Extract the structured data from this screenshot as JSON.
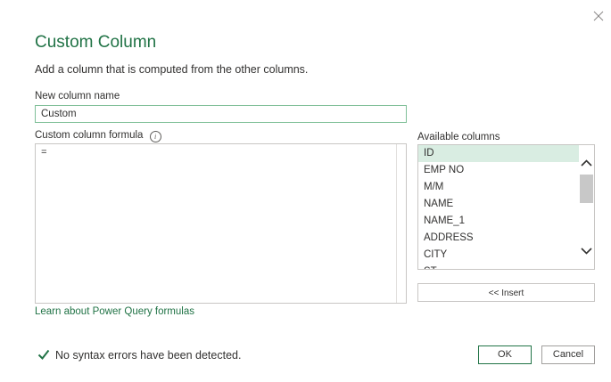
{
  "dialog": {
    "close_icon": "close-icon",
    "title": "Custom Column",
    "subtitle": "Add a column that is computed from the other columns.",
    "new_column_label": "New column name",
    "new_column_value": "Custom",
    "formula_label": "Custom column formula",
    "info_icon": "info-icon",
    "formula_value": "=",
    "available_label": "Available columns",
    "columns": [
      "ID",
      "EMP NO",
      "M/M",
      "NAME",
      "NAME_1",
      "ADDRESS",
      "CITY",
      "ST"
    ],
    "selected_column": "ID",
    "insert_label": "<< Insert",
    "learn_link": "Learn about Power Query formulas",
    "status_text": "No syntax errors have been detected.",
    "status_icon": "checkmark-icon",
    "ok_label": "OK",
    "cancel_label": "Cancel"
  },
  "colors": {
    "accent": "#217346",
    "selection": "#d9ede2",
    "border": "#c8c6c4"
  }
}
